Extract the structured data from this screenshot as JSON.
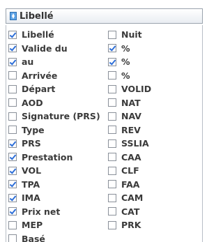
{
  "header": {
    "label": "Libellé",
    "icon": "sort-icon"
  },
  "columns": {
    "left": [
      {
        "label": "Libellé",
        "checked": true
      },
      {
        "label": "Valide du",
        "checked": true
      },
      {
        "label": "au",
        "checked": true
      },
      {
        "label": "Arrivée",
        "checked": false
      },
      {
        "label": "Départ",
        "checked": false
      },
      {
        "label": "AOD",
        "checked": false
      },
      {
        "label": "Signature (PRS)",
        "checked": false
      },
      {
        "label": "Type",
        "checked": false
      },
      {
        "label": "PRS",
        "checked": true
      },
      {
        "label": "Prestation",
        "checked": true
      },
      {
        "label": "VOL",
        "checked": true
      },
      {
        "label": "TPA",
        "checked": true
      },
      {
        "label": "IMA",
        "checked": true
      },
      {
        "label": "Prix net",
        "checked": true
      },
      {
        "label": "MEP",
        "checked": false
      },
      {
        "label": "Basé",
        "checked": false
      }
    ],
    "right": [
      {
        "label": "Nuit",
        "checked": false
      },
      {
        "label": "%",
        "checked": true
      },
      {
        "label": "%",
        "checked": true
      },
      {
        "label": "%",
        "checked": false
      },
      {
        "label": "VOLID",
        "checked": false
      },
      {
        "label": "NAT",
        "checked": false
      },
      {
        "label": "NAV",
        "checked": false
      },
      {
        "label": "REV",
        "checked": false
      },
      {
        "label": "SSLIA",
        "checked": false
      },
      {
        "label": "CAA",
        "checked": false
      },
      {
        "label": "CLF",
        "checked": false
      },
      {
        "label": "FAA",
        "checked": false
      },
      {
        "label": "CAM",
        "checked": false
      },
      {
        "label": "CAT",
        "checked": false
      },
      {
        "label": "PRK",
        "checked": false
      }
    ]
  },
  "colors": {
    "check": "#2e6fd8",
    "border": "#8a9099",
    "text": "#3a3a3a"
  }
}
